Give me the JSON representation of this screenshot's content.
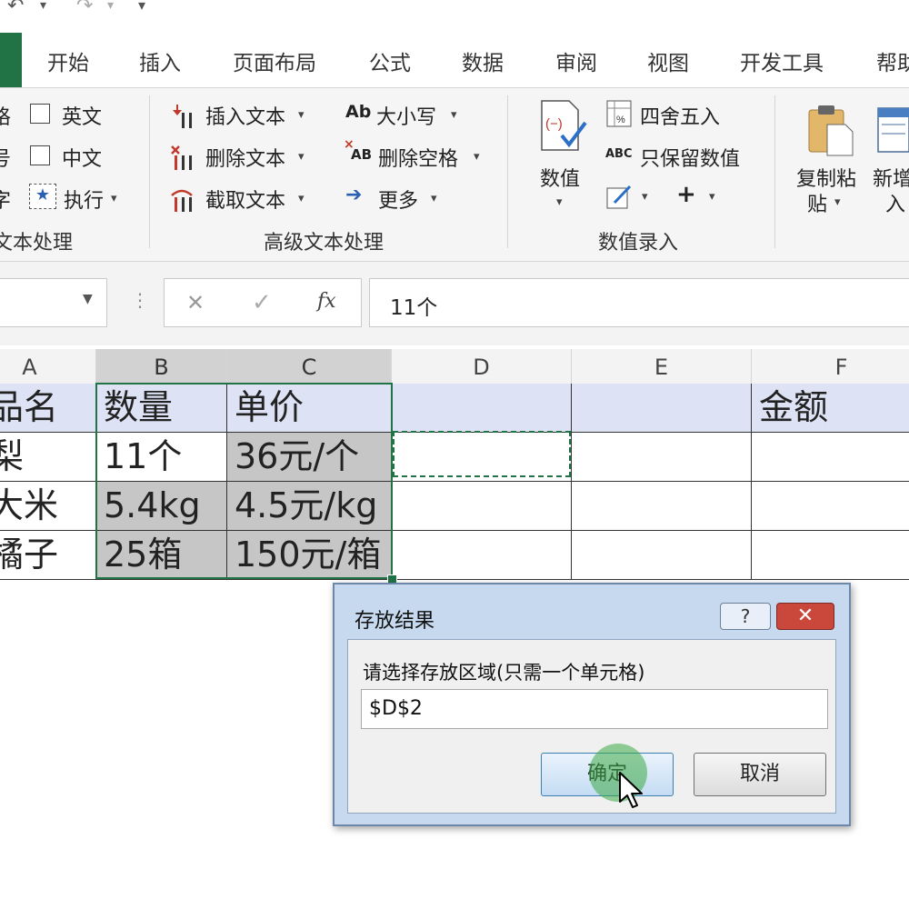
{
  "quick_access": {
    "undo_icon": "undo-icon",
    "redo_icon": "redo-icon",
    "dropdown_icon": "chevron-down-icon"
  },
  "tabs": [
    "开始",
    "插入",
    "页面布局",
    "公式",
    "数据",
    "审阅",
    "视图",
    "开发工具",
    "帮助"
  ],
  "ribbon": {
    "group1": {
      "row_labels": [
        "格",
        "号",
        "字"
      ],
      "checkbox_english": "英文",
      "checkbox_chinese": "中文",
      "execute": "执行",
      "label": "文本处理"
    },
    "group2": {
      "insert_text": "插入文本",
      "delete_text": "删除文本",
      "extract_text": "截取文本",
      "case": "大小写",
      "case_icon": "Ab",
      "remove_spaces": "删除空格",
      "remove_spaces_icon": "AB",
      "more": "更多",
      "label": "高级文本处理"
    },
    "group3": {
      "numeric": "数值",
      "round": "四舍五入",
      "keep_numbers": "只保留数值",
      "keep_numbers_icon": "ABC",
      "plus": "+",
      "label": "数值录入"
    },
    "group4": {
      "copy_paste_line1": "复制粘",
      "copy_paste_line2": "贴",
      "new_insert_line1": "新增",
      "new_insert_line2": "入"
    }
  },
  "formula_bar": {
    "cancel": "✕",
    "confirm": "✓",
    "fx": "fx",
    "value": "11个"
  },
  "sheet": {
    "columns": [
      "A",
      "B",
      "C",
      "D",
      "E",
      "F"
    ],
    "rows": [
      [
        "品名",
        "数量",
        "单价",
        "",
        "",
        "金额"
      ],
      [
        "梨",
        "11个",
        "36元/个",
        "",
        "",
        ""
      ],
      [
        "大米",
        "5.4kg",
        "4.5元/kg",
        "",
        "",
        ""
      ],
      [
        "橘子",
        "25箱",
        "150元/箱",
        "",
        "",
        ""
      ]
    ]
  },
  "dialog": {
    "title": "存放结果",
    "help": "?",
    "prompt": "请选择存放区域(只需一个单元格)",
    "value": "$D$2",
    "ok": "确定",
    "cancel": "取消"
  },
  "colors": {
    "excel_green": "#217346",
    "header_row": "#dde3f5",
    "selected_fill": "#c6c6c6",
    "dialog_bg": "#c7d9ee",
    "close_red": "#c9483b"
  }
}
